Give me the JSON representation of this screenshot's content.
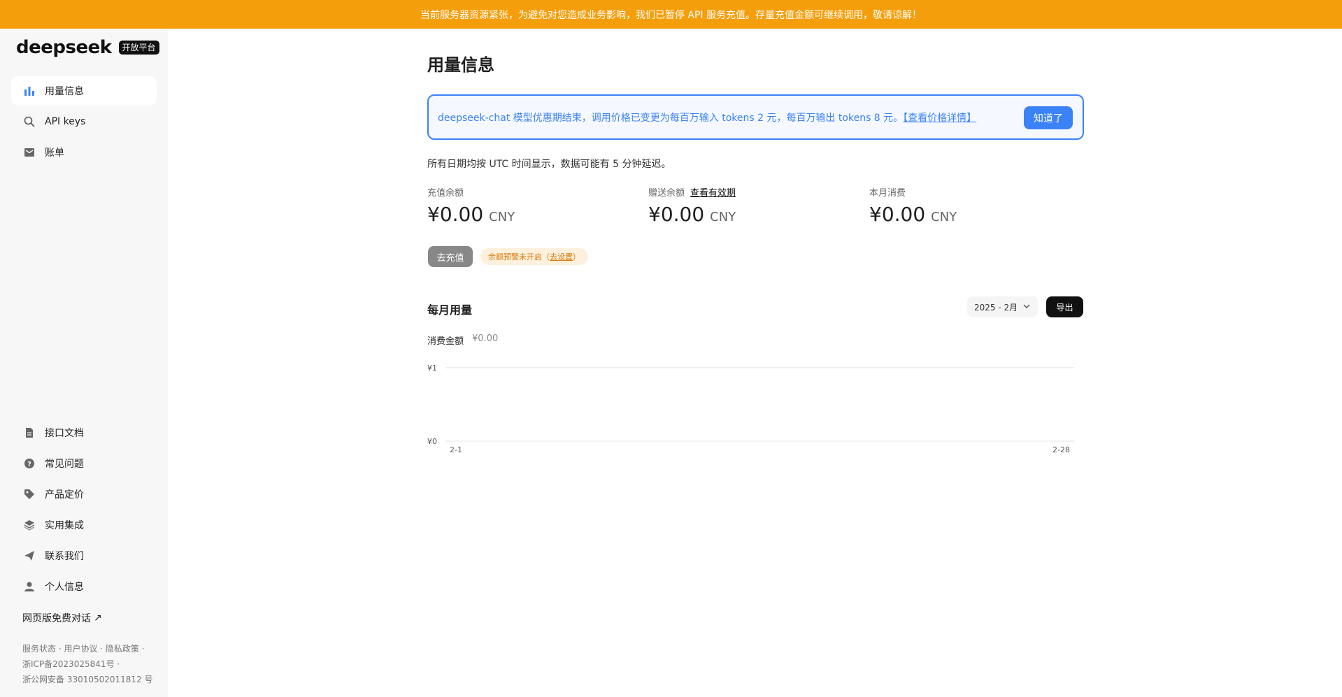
{
  "banner": {
    "text": "当前服务器资源紧张，为避免对您造成业务影响，我们已暂停 API 服务充值。存量充值金额可继续调用，敬请谅解！"
  },
  "brand": {
    "logo": "deepseek",
    "badge": "开放平台"
  },
  "sidebar": {
    "items": [
      {
        "label": "用量信息",
        "icon": "bar-chart-icon",
        "active": true
      },
      {
        "label": "API keys",
        "icon": "search-icon",
        "active": false
      },
      {
        "label": "账单",
        "icon": "inbox-icon",
        "active": false
      }
    ],
    "bottom_items": [
      {
        "label": "接口文档",
        "icon": "document-icon"
      },
      {
        "label": "常见问题",
        "icon": "question-icon"
      },
      {
        "label": "产品定价",
        "icon": "tag-icon"
      },
      {
        "label": "实用集成",
        "icon": "layers-icon"
      },
      {
        "label": "联系我们",
        "icon": "send-icon"
      },
      {
        "label": "个人信息",
        "icon": "user-icon"
      }
    ],
    "web_chat": "网页版免费对话",
    "footer": {
      "line1": "服务状态 · 用户协议 · 隐私政策 ·",
      "line2": "浙ICP备2023025841号 ·",
      "line3": "浙公网安备 33010502011812 号"
    }
  },
  "main": {
    "title": "用量信息",
    "notice": {
      "text": "deepseek-chat 模型优惠期结束，调用价格已变更为每百万输入 tokens 2 元，每百万输出 tokens 8 元。",
      "link": "【查看价格详情】",
      "button": "知道了"
    },
    "tz_note": "所有日期均按 UTC 时间显示，数据可能有 5 分钟延迟。",
    "balances": [
      {
        "label": "充值余额",
        "amount": "¥0.00",
        "currency": "CNY",
        "link": ""
      },
      {
        "label": "赠送余额",
        "amount": "¥0.00",
        "currency": "CNY",
        "link": "查看有效期"
      },
      {
        "label": "本月消费",
        "amount": "¥0.00",
        "currency": "CNY",
        "link": ""
      }
    ],
    "recharge_button": "去充值",
    "warn": {
      "text": "余额预警未开启（",
      "link": "去设置",
      "suffix": "）"
    },
    "monthly": {
      "title": "每月用量",
      "month": "2025 - 2月",
      "export": "导出",
      "cost_label": "消费金额",
      "cost_value": "¥0.00"
    }
  },
  "chart_data": {
    "type": "line",
    "x": [
      "2-1",
      "2-28"
    ],
    "series": [
      {
        "values": [
          0,
          0
        ]
      }
    ],
    "ylim": [
      0,
      1
    ],
    "yticks": [
      "¥0",
      "¥1"
    ],
    "xticks": [
      "2-1",
      "2-28"
    ],
    "grid": true
  },
  "colors": {
    "banner": "#f59e0b",
    "accent": "#3b82f6",
    "warn": "#d97706"
  }
}
